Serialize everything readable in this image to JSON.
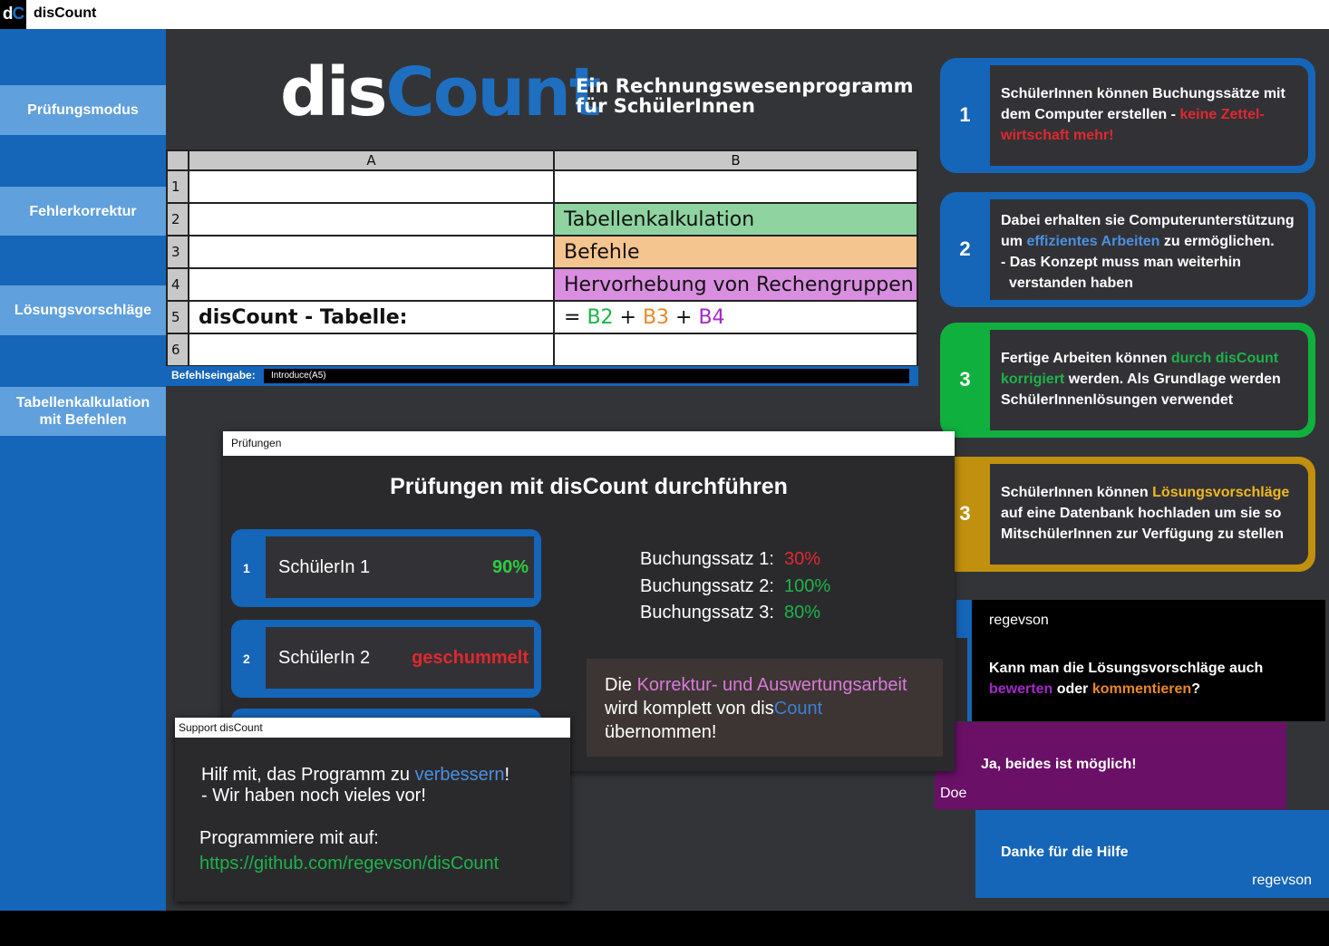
{
  "titlebar": {
    "logo_d": "d",
    "logo_c": "C",
    "title": "disCount"
  },
  "sidebar": {
    "items": [
      {
        "label": "Prüfungsmodus"
      },
      {
        "label": "Fehlerkorrektur"
      },
      {
        "label": "Lösungsvorschläge"
      },
      {
        "label": "Tabellenkalkulation mit Befehlen"
      }
    ]
  },
  "header": {
    "brand_dis": "dis",
    "brand_count": "Count",
    "tagline_1": "Ein Rechnungswesenprogramm",
    "tagline_2": "für SchülerInnen"
  },
  "sheet": {
    "columns": [
      "A",
      "B"
    ],
    "rows": [
      "1",
      "2",
      "3",
      "4",
      "5",
      "6"
    ],
    "b2": "Tabellenkalkulation",
    "b3": "Befehle",
    "b4": "Hervorhebung von Rechengruppen",
    "a5": "disCount - Tabelle:",
    "b5_eq": "= ",
    "b5_r1": "B2",
    "b5_plus1": " + ",
    "b5_r2": "B3",
    "b5_plus2": " + ",
    "b5_r3": "B4",
    "colors": {
      "b2": "#8fd4a0",
      "b3": "#f5c590",
      "b4": "#d98ee0"
    },
    "cmd_label": "Befehlseingabe:",
    "cmd_value": "Introduce(A5)"
  },
  "pruefungen": {
    "window_title": "Prüfungen",
    "title": "Prüfungen mit disCount durchführen",
    "students": [
      {
        "num": "1",
        "name": "SchülerIn 1",
        "score": "90%",
        "color": "#2ecc40"
      },
      {
        "num": "2",
        "name": "SchülerIn 2",
        "score": "geschummelt",
        "color": "#e0282e"
      }
    ],
    "buchungssaetze": [
      {
        "label": "Buchungssatz 1:",
        "value": "30%",
        "color": "#e0282e"
      },
      {
        "label": "Buchungssatz 2:",
        "value": "100%",
        "color": "#1db34a"
      },
      {
        "label": "Buchungssatz 3:",
        "value": "80%",
        "color": "#1db34a"
      }
    ],
    "korr_1": "Die ",
    "korr_2": "Korrektur- und Auswertungsarbeit",
    "korr_3": "wird komplett von dis",
    "korr_4": "Count",
    "korr_5": "übernommen!"
  },
  "support": {
    "window_title": "Support disCount",
    "line1_a": "Hilf mit, das Programm zu ",
    "line1_b": "verbessern",
    "line1_c": "!",
    "line2": "- Wir haben noch vieles vor!",
    "line3": "Programmiere mit auf:",
    "link": "https://github.com/regevson/disCount"
  },
  "features": [
    {
      "num": "1",
      "color": "#1565b8",
      "t1": "SchülerInnen können Buchungssätze mit",
      "t2": "dem Computer erstellen - ",
      "t2_hl": "keine Zettel-",
      "t3_hl": "wirtschaft mehr!"
    },
    {
      "num": "2",
      "color": "#1565b8",
      "t1": "Dabei erhalten sie Computerunterstützung",
      "t2_a": "um ",
      "t2_hl": "effizientes Arbeiten",
      "t2_b": " zu ermöglichen.",
      "t3": "- Das Konzept muss man weiterhin",
      "t4": "verstanden haben"
    },
    {
      "num": "3",
      "color": "#10b03e",
      "t1_a": "Fertige Arbeiten können ",
      "t1_hl": "durch disCount",
      "t2_hl": "korrigiert",
      "t2_b": " werden. Als Grundlage werden",
      "t3": "SchülerInnenlösungen verwendet"
    },
    {
      "num": "3",
      "color": "#c0900e",
      "t1_a": "SchülerInnen können ",
      "t1_hl": "Lösungsvorschläge",
      "t2": "auf eine Datenbank hochladen um sie so",
      "t3": "MitschülerInnen zur Verfügung zu stellen"
    }
  ],
  "chat": {
    "q_user": "regevson",
    "q_1": "Kann man die Lösungsvorschläge auch",
    "q_2a": "bewerten",
    "q_2b": " oder ",
    "q_2c": "kommentieren",
    "q_2d": "?",
    "a_msg": "Ja, beides ist möglich!",
    "a_user": "Doe",
    "t_msg": "Danke für die Hilfe",
    "t_user": "regevson"
  }
}
